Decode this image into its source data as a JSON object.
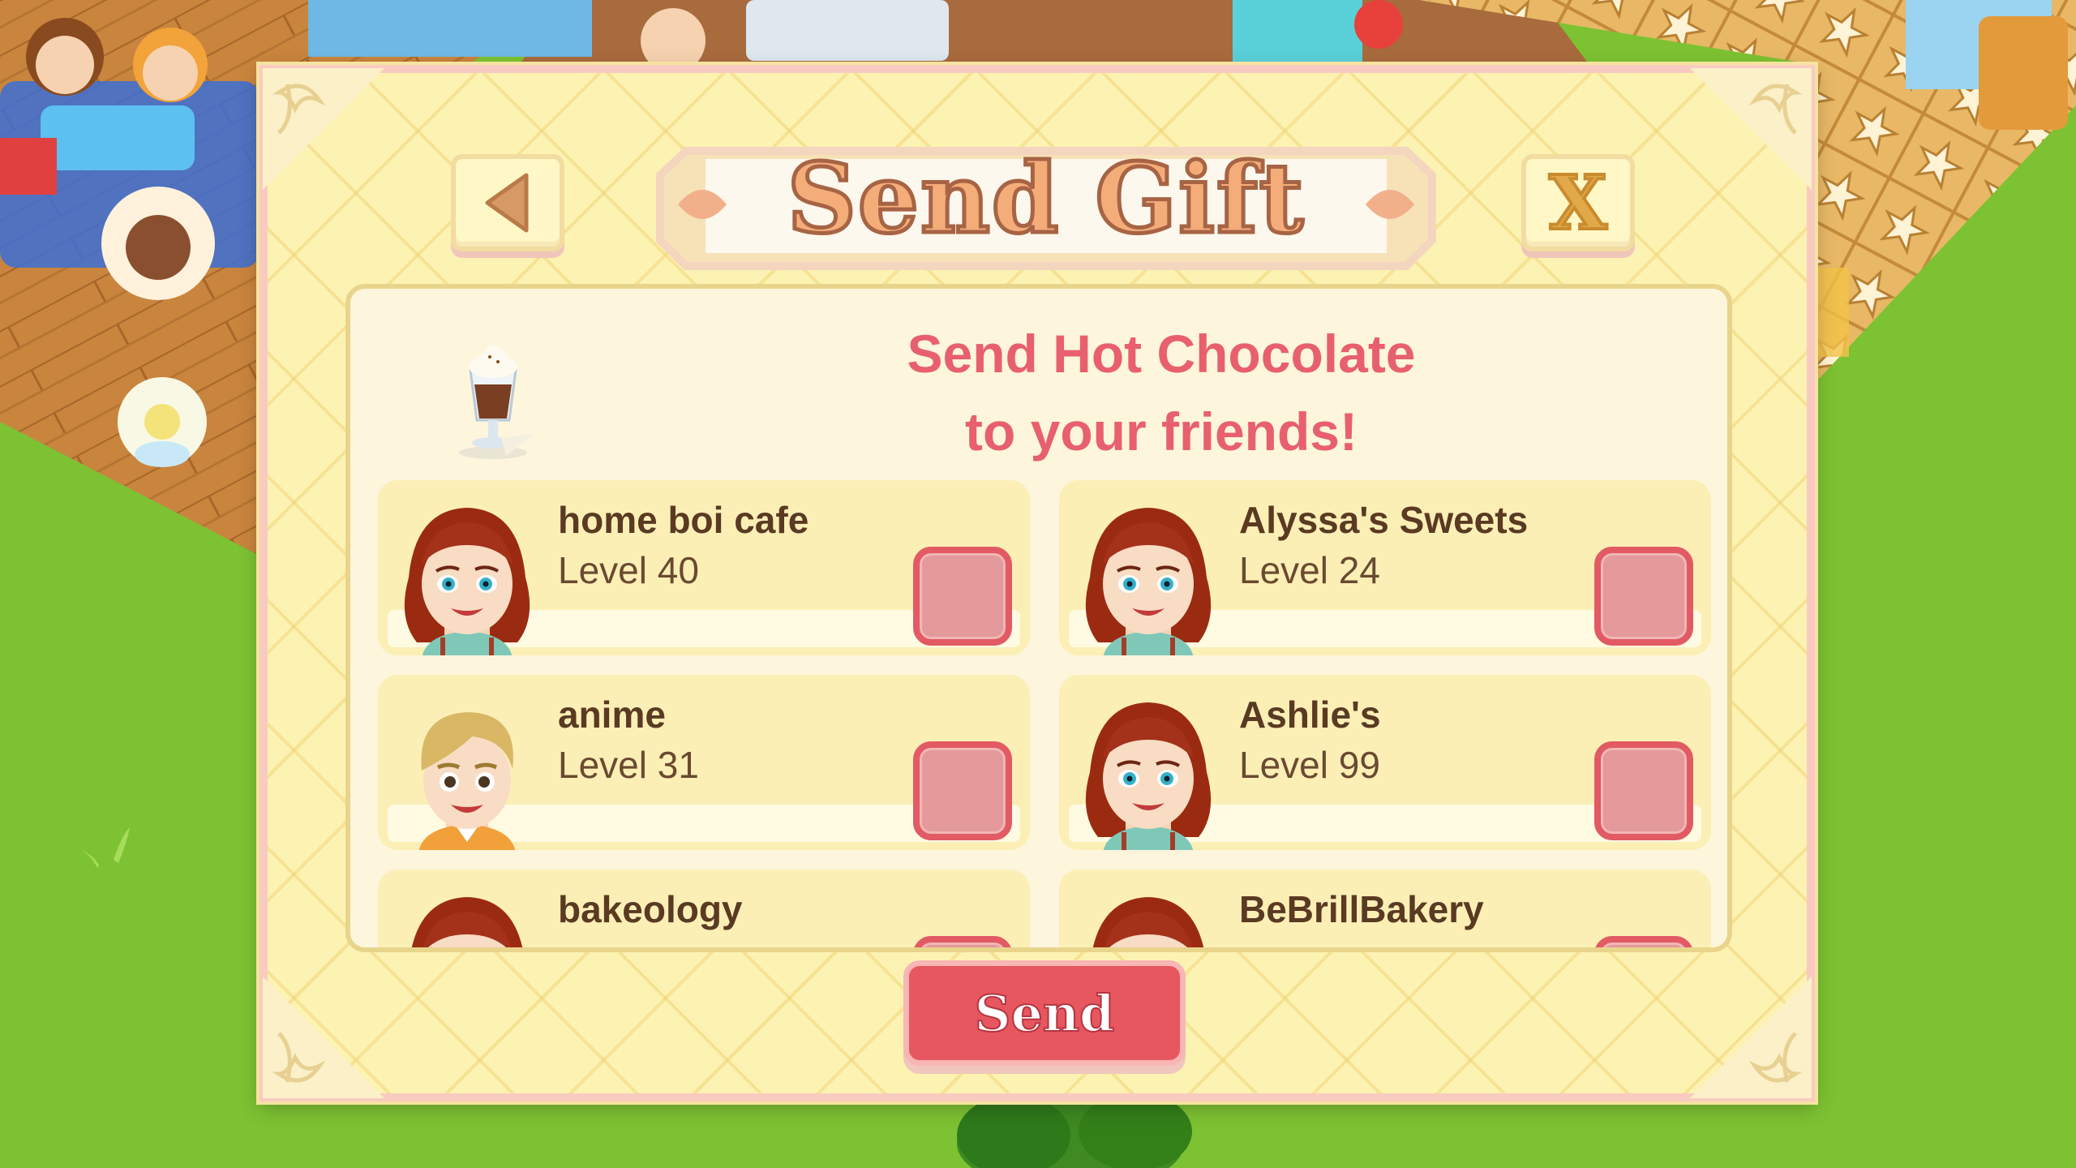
{
  "dialog": {
    "title": "Send Gift",
    "close_label": "X",
    "headline_line1": "Send Hot Chocolate",
    "headline_line2": "to your friends!",
    "send_label": "Send",
    "friends": [
      {
        "name": "home boi cafe",
        "level": "Level 40",
        "avatar": "female-avatar"
      },
      {
        "name": "Alyssa's Sweets",
        "level": "Level 24",
        "avatar": "female-avatar"
      },
      {
        "name": "anime",
        "level": "Level 31",
        "avatar": "male-avatar"
      },
      {
        "name": "Ashlie's",
        "level": "Level 99",
        "avatar": "female-avatar"
      },
      {
        "name": "bakeology",
        "level": "",
        "avatar": "female-avatar"
      },
      {
        "name": "BeBrillBakery",
        "level": "",
        "avatar": "female-avatar"
      }
    ]
  },
  "gift_icon": "hot-chocolate-icon",
  "colors": {
    "accent_red": "#e7575f",
    "headline": "#e8606d",
    "modal_bg": "#fcf3b3",
    "modal_border": "#f9cbc0",
    "grass": "#7dc232"
  }
}
